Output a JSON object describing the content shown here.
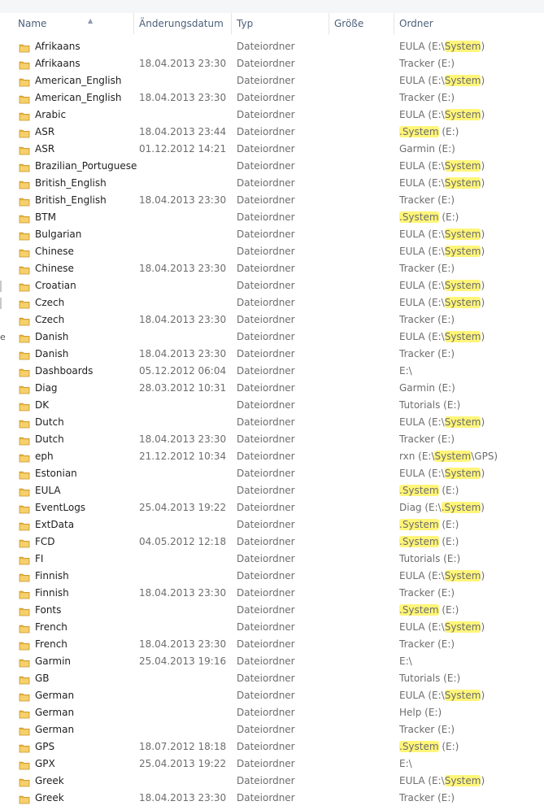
{
  "columns": {
    "name": "Name",
    "date": "Änderungsdatum",
    "type": "Typ",
    "size": "Größe",
    "folder": "Ordner"
  },
  "icons": {
    "folder": "folder-icon",
    "sort": "sort-ascending-icon"
  },
  "colors": {
    "highlight": "#fff579",
    "header_text": "#4c607a",
    "folder_icon": "#e8b53c"
  },
  "edge_fragment": "e",
  "files": [
    {
      "name": "Afrikaans",
      "date": "",
      "type": "Dateiordner",
      "folder": [
        "EULA (E:\\",
        "System",
        ")"
      ]
    },
    {
      "name": "Afrikaans",
      "date": "18.04.2013 23:30",
      "type": "Dateiordner",
      "folder": [
        "Tracker (E:)"
      ]
    },
    {
      "name": "American_English",
      "date": "",
      "type": "Dateiordner",
      "folder": [
        "EULA (E:\\",
        "System",
        ")"
      ]
    },
    {
      "name": "American_English",
      "date": "18.04.2013 23:30",
      "type": "Dateiordner",
      "folder": [
        "Tracker (E:)"
      ]
    },
    {
      "name": "Arabic",
      "date": "",
      "type": "Dateiordner",
      "folder": [
        "EULA (E:\\",
        "System",
        ")"
      ]
    },
    {
      "name": "ASR",
      "date": "18.04.2013 23:44",
      "type": "Dateiordner",
      "folder": [
        "",
        ".System",
        " (E:)"
      ]
    },
    {
      "name": "ASR",
      "date": "01.12.2012 14:21",
      "type": "Dateiordner",
      "folder": [
        "Garmin (E:)"
      ]
    },
    {
      "name": "Brazilian_Portuguese",
      "date": "",
      "type": "Dateiordner",
      "folder": [
        "EULA (E:\\",
        "System",
        ")"
      ]
    },
    {
      "name": "British_English",
      "date": "",
      "type": "Dateiordner",
      "folder": [
        "EULA (E:\\",
        "System",
        ")"
      ]
    },
    {
      "name": "British_English",
      "date": "18.04.2013 23:30",
      "type": "Dateiordner",
      "folder": [
        "Tracker (E:)"
      ]
    },
    {
      "name": "BTM",
      "date": "",
      "type": "Dateiordner",
      "folder": [
        "",
        ".System",
        " (E:)"
      ]
    },
    {
      "name": "Bulgarian",
      "date": "",
      "type": "Dateiordner",
      "folder": [
        "EULA (E:\\",
        "System",
        ")"
      ]
    },
    {
      "name": "Chinese",
      "date": "",
      "type": "Dateiordner",
      "folder": [
        "EULA (E:\\",
        "System",
        ")"
      ]
    },
    {
      "name": "Chinese",
      "date": "18.04.2013 23:30",
      "type": "Dateiordner",
      "folder": [
        "Tracker (E:)"
      ]
    },
    {
      "name": "Croatian",
      "date": "",
      "type": "Dateiordner",
      "folder": [
        "EULA (E:\\",
        "System",
        ")"
      ]
    },
    {
      "name": "Czech",
      "date": "",
      "type": "Dateiordner",
      "folder": [
        "EULA (E:\\",
        "System",
        ")"
      ]
    },
    {
      "name": "Czech",
      "date": "18.04.2013 23:30",
      "type": "Dateiordner",
      "folder": [
        "Tracker (E:)"
      ]
    },
    {
      "name": "Danish",
      "date": "",
      "type": "Dateiordner",
      "folder": [
        "EULA (E:\\",
        "System",
        ")"
      ]
    },
    {
      "name": "Danish",
      "date": "18.04.2013 23:30",
      "type": "Dateiordner",
      "folder": [
        "Tracker (E:)"
      ]
    },
    {
      "name": "Dashboards",
      "date": "05.12.2012 06:04",
      "type": "Dateiordner",
      "folder": [
        "E:\\"
      ]
    },
    {
      "name": "Diag",
      "date": "28.03.2012 10:31",
      "type": "Dateiordner",
      "folder": [
        "Garmin (E:)"
      ]
    },
    {
      "name": "DK",
      "date": "",
      "type": "Dateiordner",
      "folder": [
        "Tutorials (E:)"
      ]
    },
    {
      "name": "Dutch",
      "date": "",
      "type": "Dateiordner",
      "folder": [
        "EULA (E:\\",
        "System",
        ")"
      ]
    },
    {
      "name": "Dutch",
      "date": "18.04.2013 23:30",
      "type": "Dateiordner",
      "folder": [
        "Tracker (E:)"
      ]
    },
    {
      "name": "eph",
      "date": "21.12.2012 10:34",
      "type": "Dateiordner",
      "folder": [
        "rxn (E:\\",
        "System",
        "\\GPS)"
      ]
    },
    {
      "name": "Estonian",
      "date": "",
      "type": "Dateiordner",
      "folder": [
        "EULA (E:\\",
        "System",
        ")"
      ]
    },
    {
      "name": "EULA",
      "date": "",
      "type": "Dateiordner",
      "folder": [
        "",
        ".System",
        " (E:)"
      ]
    },
    {
      "name": "EventLogs",
      "date": "25.04.2013 19:22",
      "type": "Dateiordner",
      "folder": [
        "Diag (E:\\",
        ".System",
        ")"
      ]
    },
    {
      "name": "ExtData",
      "date": "",
      "type": "Dateiordner",
      "folder": [
        "",
        ".System",
        " (E:)"
      ]
    },
    {
      "name": "FCD",
      "date": "04.05.2012 12:18",
      "type": "Dateiordner",
      "folder": [
        "",
        ".System",
        " (E:)"
      ]
    },
    {
      "name": "FI",
      "date": "",
      "type": "Dateiordner",
      "folder": [
        "Tutorials (E:)"
      ]
    },
    {
      "name": "Finnish",
      "date": "",
      "type": "Dateiordner",
      "folder": [
        "EULA (E:\\",
        "System",
        ")"
      ]
    },
    {
      "name": "Finnish",
      "date": "18.04.2013 23:30",
      "type": "Dateiordner",
      "folder": [
        "Tracker (E:)"
      ]
    },
    {
      "name": "Fonts",
      "date": "",
      "type": "Dateiordner",
      "folder": [
        "",
        ".System",
        " (E:)"
      ]
    },
    {
      "name": "French",
      "date": "",
      "type": "Dateiordner",
      "folder": [
        "EULA (E:\\",
        "System",
        ")"
      ]
    },
    {
      "name": "French",
      "date": "18.04.2013 23:30",
      "type": "Dateiordner",
      "folder": [
        "Tracker (E:)"
      ]
    },
    {
      "name": "Garmin",
      "date": "25.04.2013 19:16",
      "type": "Dateiordner",
      "folder": [
        "E:\\"
      ]
    },
    {
      "name": "GB",
      "date": "",
      "type": "Dateiordner",
      "folder": [
        "Tutorials (E:)"
      ]
    },
    {
      "name": "German",
      "date": "",
      "type": "Dateiordner",
      "folder": [
        "EULA (E:\\",
        "System",
        ")"
      ]
    },
    {
      "name": "German",
      "date": "",
      "type": "Dateiordner",
      "folder": [
        "Help (E:)"
      ]
    },
    {
      "name": "German",
      "date": "",
      "type": "Dateiordner",
      "folder": [
        "Tracker (E:)"
      ]
    },
    {
      "name": "GPS",
      "date": "18.07.2012 18:18",
      "type": "Dateiordner",
      "folder": [
        "",
        ".System",
        " (E:)"
      ]
    },
    {
      "name": "GPX",
      "date": "25.04.2013 19:22",
      "type": "Dateiordner",
      "folder": [
        "E:\\"
      ]
    },
    {
      "name": "Greek",
      "date": "",
      "type": "Dateiordner",
      "folder": [
        "EULA (E:\\",
        "System",
        ")"
      ]
    },
    {
      "name": "Greek",
      "date": "18.04.2013 23:30",
      "type": "Dateiordner",
      "folder": [
        "Tracker (E:)"
      ]
    }
  ]
}
